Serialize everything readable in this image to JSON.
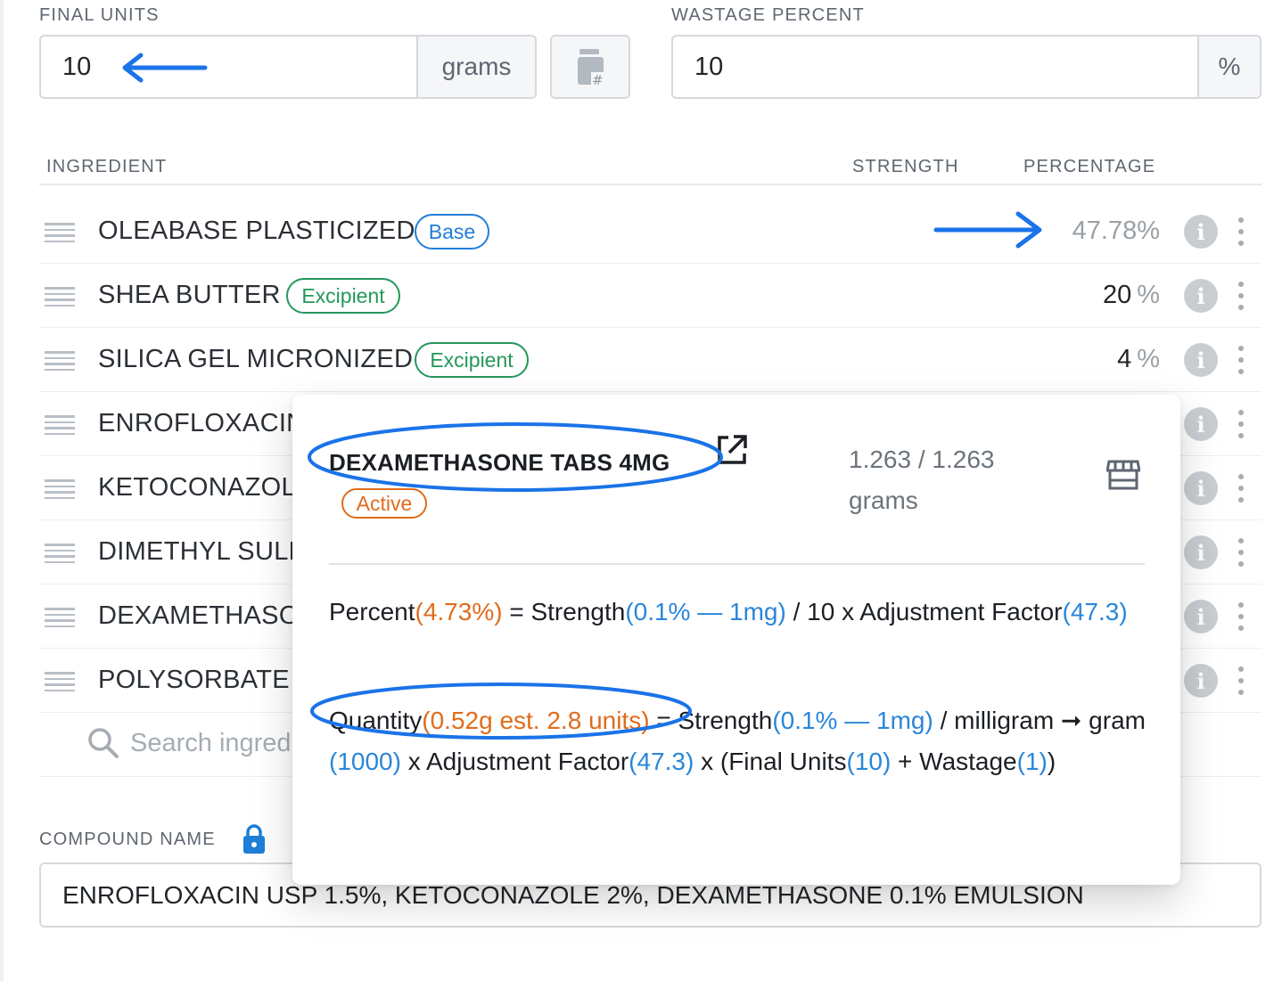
{
  "final_units": {
    "label": "FINAL UNITS",
    "value": "10",
    "unit": "grams"
  },
  "wastage": {
    "label": "WASTAGE PERCENT",
    "value": "10",
    "unit": "%"
  },
  "columns": {
    "ingredient": "INGREDIENT",
    "strength": "STRENGTH",
    "percentage": "PERCENTAGE"
  },
  "ingredients": [
    {
      "name": "OLEABASE PLASTICIZED",
      "badge": "Base",
      "badge_type": "base",
      "percentage": "47.78%"
    },
    {
      "name": "SHEA BUTTER",
      "badge": "Excipient",
      "badge_type": "excipient",
      "percentage": "20",
      "unit": "%"
    },
    {
      "name": "SILICA GEL MICRONIZED",
      "badge": "Excipient",
      "badge_type": "excipient",
      "percentage": "4",
      "unit": "%"
    },
    {
      "name": "ENROFLOXACIN"
    },
    {
      "name": "KETOCONAZOLE"
    },
    {
      "name": "DIMETHYL SULFOXIDE"
    },
    {
      "name": "DEXAMETHASONE"
    },
    {
      "name": "POLYSORBATE 80"
    }
  ],
  "search": {
    "placeholder": "Search ingredients"
  },
  "compound": {
    "label": "COMPOUND NAME",
    "value": "ENROFLOXACIN USP 1.5%, KETOCONAZOLE 2%, DEXAMETHASONE 0.1% EMULSION"
  },
  "popover": {
    "title": "DEXAMETHASONE TABS 4MG",
    "badge": "Active",
    "quantity_line1": "1.263 / 1.263",
    "quantity_line2": "grams",
    "percent_formula": {
      "p1": "Percent",
      "p2": "(4.73%)",
      "p3": " = Strength",
      "p4": "(0.1% — 1mg)",
      "p5": " / 10 x Adjustment Factor",
      "p6": "(47.3)"
    },
    "quantity_formula": {
      "q1": "Quantity",
      "q2": "(0.52g est. 2.8 units)",
      "q3": " = Strength",
      "q4": "(0.1% — 1mg)",
      "q5": " / milligram ➞ gram ",
      "q6": "(1000)",
      "q7": " x Adjustment Factor",
      "q8": "(47.3)",
      "q9": " x (Final Units",
      "q10": "(10)",
      "q11": " + Wastage",
      "q12": "(1)",
      "q13": ")"
    }
  },
  "colors": {
    "accent_blue": "#1f7ed8",
    "excipient_green": "#23985a",
    "active_orange": "#e06c1b",
    "annotation_blue": "#1a73e8"
  }
}
